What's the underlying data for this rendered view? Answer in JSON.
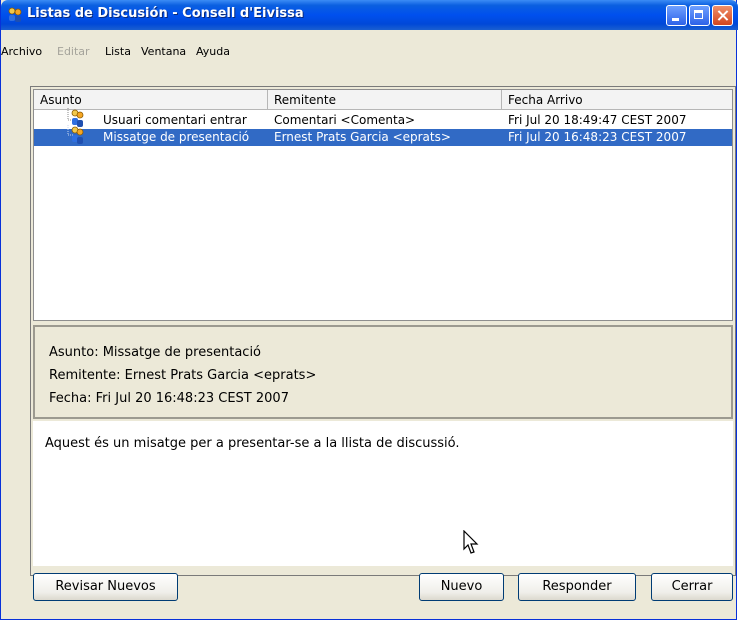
{
  "window": {
    "title": "Listas de Discusión - Consell d'Eivissa"
  },
  "menu": [
    "Archivo",
    "Editar",
    "Lista",
    "Ventana",
    "Ayuda"
  ],
  "menu_disabled": [
    "Editar"
  ],
  "table": {
    "columns": [
      "Asunto",
      "Remitente",
      "Fecha Arrivo"
    ],
    "rows": [
      {
        "asunto": "Usuari comentari entrar",
        "remitente": "Comentari <Comenta>",
        "fecha": "Fri Jul 20 18:49:47 CEST 2007",
        "selected": false
      },
      {
        "asunto": "Missatge de presentació",
        "remitente": "Ernest Prats Garcia <eprats>",
        "fecha": "Fri Jul 20 16:48:23 CEST 2007",
        "selected": true
      }
    ]
  },
  "detail": {
    "asunto": "Asunto: Missatge de presentació",
    "remitente": "Remitente: Ernest Prats Garcia <eprats>",
    "fecha": "Fecha: Fri Jul 20 16:48:23 CEST 2007"
  },
  "message_body": "Aquest és un misatge per a presentar-se a la llista de discussió.",
  "buttons": {
    "revisar": "Revisar Nuevos",
    "nuevo": "Nuevo",
    "responder": "Responder",
    "cerrar": "Cerrar"
  },
  "colors": {
    "titlebar": "#0050ee",
    "selection": "#316ac5",
    "window_bg": "#ece9d8"
  },
  "icons": [
    "people-group-icon",
    "minimize-icon",
    "maximize-icon",
    "close-icon",
    "mouse-cursor-icon"
  ]
}
